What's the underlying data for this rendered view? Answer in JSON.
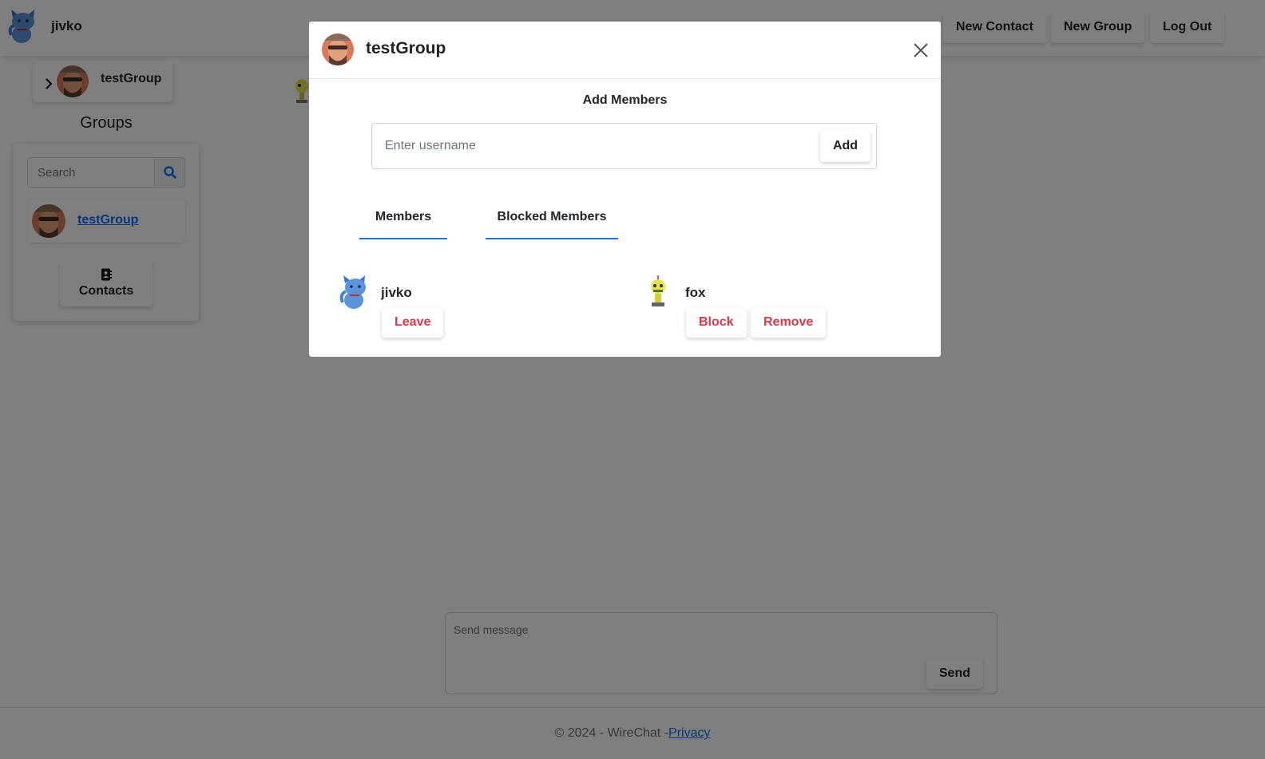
{
  "navbar": {
    "username": "jivko",
    "buttons": {
      "new_contact": "New Contact",
      "new_group": "New Group",
      "log_out": "Log Out"
    }
  },
  "sidebar": {
    "current_chat": "testGroup",
    "groups_heading": "Groups",
    "search_placeholder": "Search",
    "groups": [
      {
        "name": "testGroup"
      }
    ],
    "contacts_label": "Contacts"
  },
  "composer": {
    "placeholder": "Send message",
    "send_label": "Send"
  },
  "footer": {
    "copyright": "© 2024 - WireChat - ",
    "privacy_label": "Privacy"
  },
  "modal": {
    "title": "testGroup",
    "add_members_heading": "Add Members",
    "username_placeholder": "Enter username",
    "add_label": "Add",
    "tabs": {
      "members": "Members",
      "blocked": "Blocked Members"
    },
    "members": [
      {
        "name": "jivko",
        "actions": [
          "Leave"
        ]
      },
      {
        "name": "fox",
        "actions": [
          "Block",
          "Remove"
        ]
      }
    ]
  },
  "colors": {
    "accent_blue": "#0d6efd",
    "tab_underline": "#1f78c8",
    "danger": "#dc3545",
    "backdrop": "rgba(0,0,0,0.5)"
  }
}
